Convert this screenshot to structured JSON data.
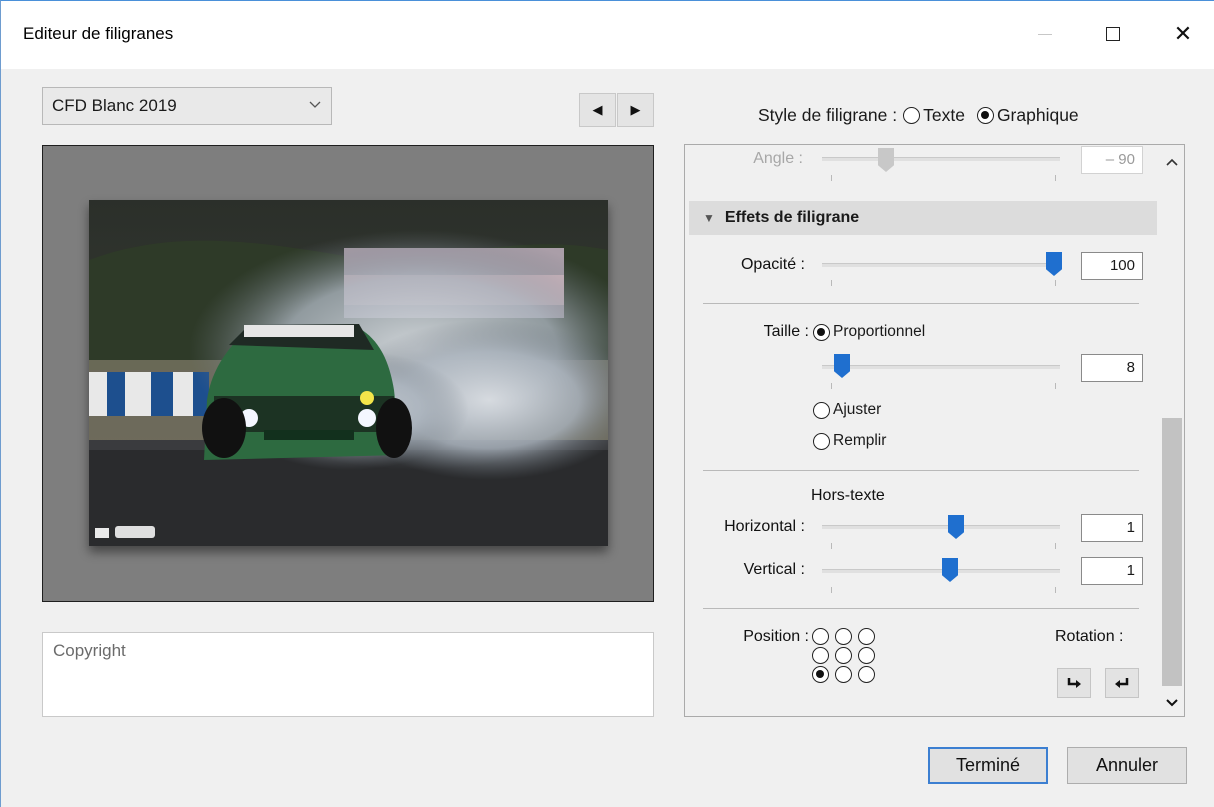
{
  "window": {
    "title": "Editeur de filigranes",
    "controls": {
      "minimize": "—",
      "maximize": "□",
      "close": "✕"
    }
  },
  "preset": {
    "selected": "CFD Blanc 2019"
  },
  "preview_nav": {
    "prev": "◀",
    "next": "▶"
  },
  "copyright": {
    "placeholder": "Copyright"
  },
  "style": {
    "label": "Style de filigrane :",
    "options": [
      "Texte",
      "Graphique"
    ],
    "selected": "Graphique"
  },
  "panel": {
    "angle": {
      "label": "Angle :",
      "value": "– 90"
    },
    "effects_header": "Effets de filigrane",
    "opacity": {
      "label": "Opacité :",
      "value": "100"
    },
    "size": {
      "label": "Taille :",
      "options": [
        "Proportionnel",
        "Ajuster",
        "Remplir"
      ],
      "selected": "Proportionnel",
      "value": "8"
    },
    "offset": {
      "title": "Hors-texte",
      "horizontal_label": "Horizontal :",
      "horizontal_value": "1",
      "vertical_label": "Vertical :",
      "vertical_value": "1"
    },
    "position": {
      "label": "Position :",
      "selected_index": 6
    },
    "rotation": {
      "label": "Rotation :"
    }
  },
  "buttons": {
    "done": "Terminé",
    "cancel": "Annuler"
  },
  "colors": {
    "accent": "#1f6fcf",
    "primary_border": "#3c7fd1"
  }
}
